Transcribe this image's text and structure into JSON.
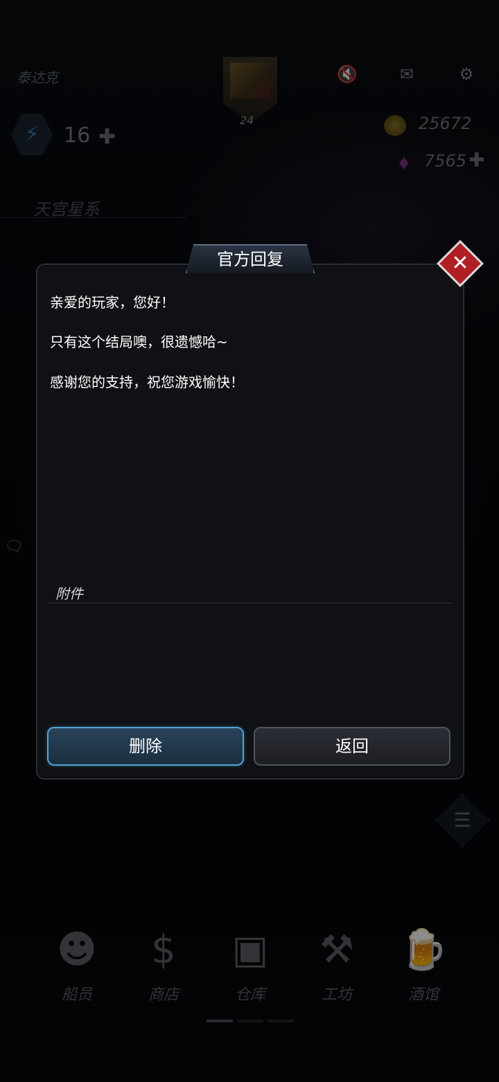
{
  "hud": {
    "name": "泰达克",
    "level": "24",
    "energy": "16",
    "coins": "25672",
    "gems": "7565",
    "galaxy": "天宫星系"
  },
  "dialog": {
    "title": "官方回复",
    "messages": [
      "亲爱的玩家，您好！",
      "只有这个结局噢，很遗憾哈~",
      "感谢您的支持，祝您游戏愉快！"
    ],
    "attachment_label": "附件",
    "delete_label": "删除",
    "back_label": "返回",
    "close_glyph": "✕"
  },
  "bottom_nav": [
    {
      "label": "船员",
      "icon": "crew-icon"
    },
    {
      "label": "商店",
      "icon": "shop-icon"
    },
    {
      "label": "仓库",
      "icon": "warehouse-icon"
    },
    {
      "label": "工坊",
      "icon": "workshop-icon"
    },
    {
      "label": "酒馆",
      "icon": "tavern-icon"
    }
  ],
  "colors": {
    "delete_border": "#52a4d6",
    "close_red": "#b01f24"
  }
}
